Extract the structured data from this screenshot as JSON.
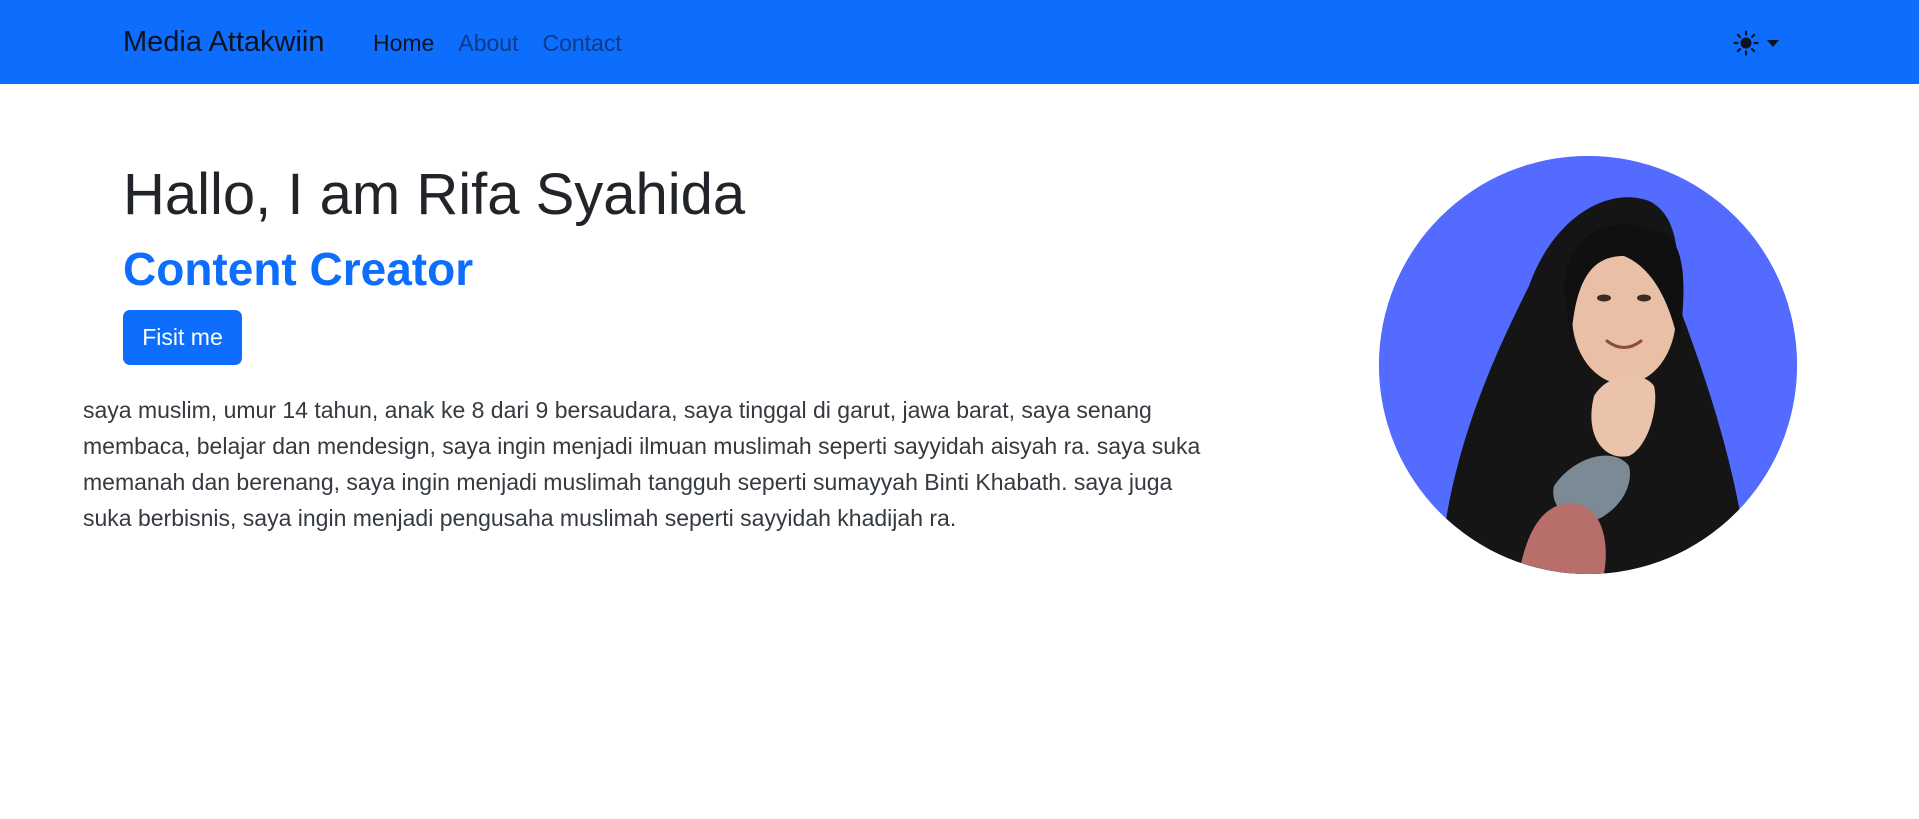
{
  "navbar": {
    "brand": "Media Attakwiin",
    "links": [
      {
        "label": "Home",
        "active": true
      },
      {
        "label": "About",
        "active": false
      },
      {
        "label": "Contact",
        "active": false
      }
    ],
    "theme_toggle_icon": "sun-icon",
    "theme_toggle_caret_icon": "caret-down-icon"
  },
  "hero": {
    "title": "Hallo, I am Rifa Syahida",
    "subtitle": "Content Creator",
    "button_label": "Fisit me",
    "bio": "saya muslim, umur 14 tahun, anak ke 8 dari 9 bersaudara, saya tinggal di garut, jawa barat, saya senang membaca, belajar dan mendesign, saya ingin menjadi ilmuan muslimah seperti sayyidah aisyah ra. saya suka memanah dan berenang, saya ingin menjadi muslimah tangguh seperti sumayyah Binti Khabath. saya juga suka berbisnis, saya ingin menjadi pengusaha muslimah seperti sayyidah khadijah ra."
  },
  "colors": {
    "primary": "#0d6efd",
    "avatar_background": "#536bff",
    "text": "#212529"
  }
}
